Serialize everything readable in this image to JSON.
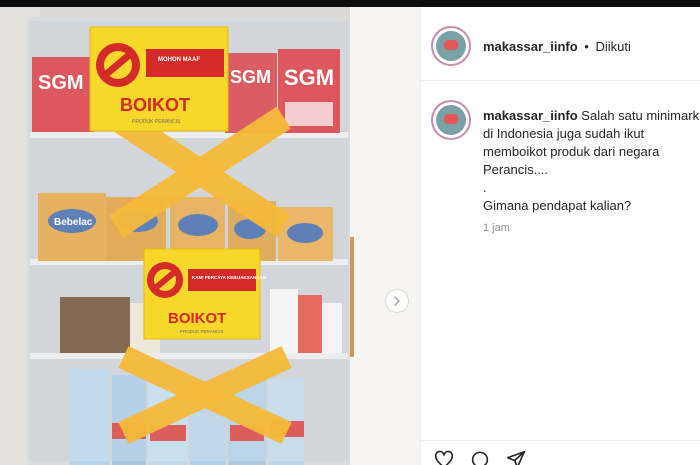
{
  "window": {
    "top_bar_color": "#0d0d0d"
  },
  "photo": {
    "sign_top": {
      "heading": "MOHON MAAF",
      "title": "BOIKOT",
      "footer": "PRODUK PERANCIS"
    },
    "sign_bottom": {
      "heading": "KAMI PERCAYA KEBIJAKSANAAN",
      "title": "BOIKOT",
      "footer": "PRODUK PERANCIS"
    },
    "brand_label": "SGM",
    "brand_label_2": "Bebelac",
    "tape_color": "#f5b93a"
  },
  "header": {
    "username": "makassar_iinfo",
    "separator": "•",
    "follow_status": "Diikuti"
  },
  "post": {
    "username": "makassar_iinfo",
    "caption_lines": [
      "Salah satu minimarket",
      "di Indonesia juga sudah ikut",
      "memboikot produk dari negara",
      "Perancis....",
      ".",
      "Gimana pendapat kalian?"
    ],
    "time": "1 jam"
  },
  "icons": {
    "next": "chevron-right-icon",
    "like": "heart-icon",
    "comment": "comment-icon",
    "share": "send-icon"
  },
  "colors": {
    "accent_ring": "#c78db0",
    "muted_text": "#8e8e8e"
  }
}
